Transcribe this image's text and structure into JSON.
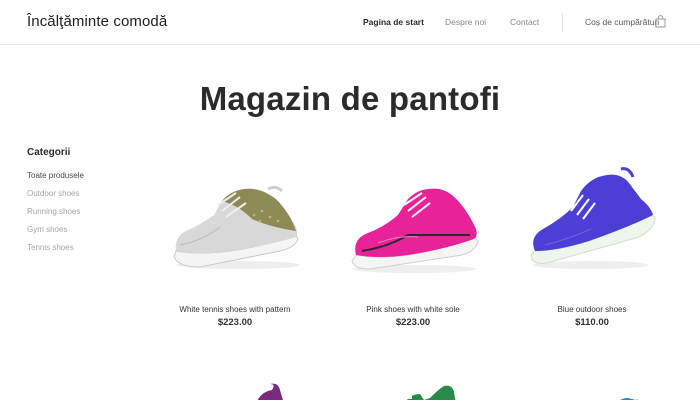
{
  "header": {
    "brand": "Încălţăminte comodă",
    "nav": [
      {
        "label": "Pagina de start",
        "active": true
      },
      {
        "label": "Despre noi",
        "active": false
      },
      {
        "label": "Contact",
        "active": false
      }
    ],
    "cart_label": "Coș de cumpărături"
  },
  "main": {
    "title": "Magazin de pantofi"
  },
  "sidebar": {
    "title": "Categorii",
    "categories": [
      {
        "label": "Toate produsele",
        "active": true
      },
      {
        "label": "Outdoor shoes",
        "active": false
      },
      {
        "label": "Running shoes",
        "active": false
      },
      {
        "label": "Gym shoes",
        "active": false
      },
      {
        "label": "Tennis shoes",
        "active": false
      }
    ]
  },
  "products": [
    {
      "name": "White tennis shoes with pattern",
      "price": "$223.00",
      "color": "#8e8a55"
    },
    {
      "name": "Pink shoes with white sole",
      "price": "$223.00",
      "color": "#e8239a"
    },
    {
      "name": "Blue outdoor shoes",
      "price": "$110.00",
      "color": "#4b3fd6"
    }
  ],
  "icons": {
    "cart": "shopping-bag-icon"
  }
}
